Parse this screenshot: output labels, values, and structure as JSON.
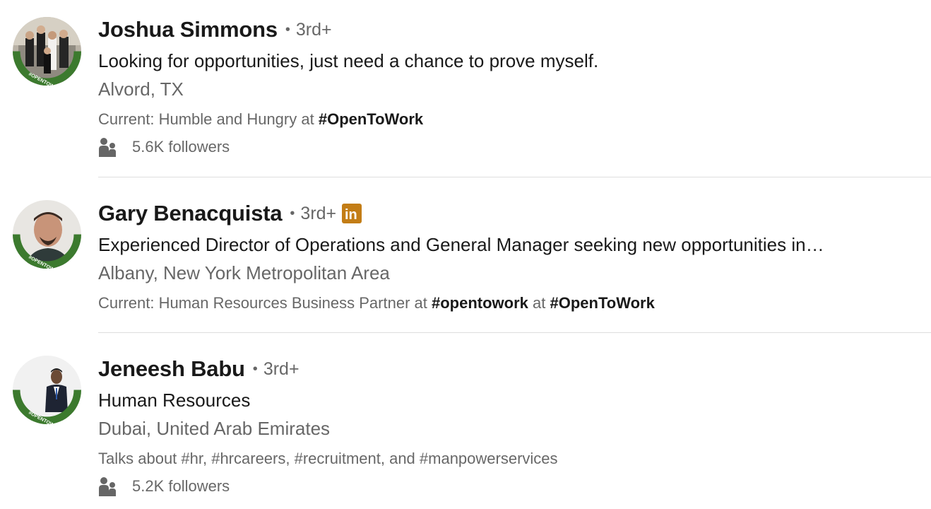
{
  "results": [
    {
      "name": "Joshua Simmons",
      "separator": "•",
      "degree": "3rd+",
      "headline": "Looking for opportunities, just need a chance to prove myself.",
      "location": "Alvord, TX",
      "summary_prefix": "Current: Humble and Hungry at ",
      "summary_hash1": "#",
      "summary_tag1": "OpenToWork",
      "followers": "5.6K followers",
      "avatar_frame_text": "#OPENTOWORK"
    },
    {
      "name": "Gary Benacquista",
      "separator": "•",
      "degree": "3rd+",
      "badge_text": "in",
      "headline": "Experienced Director of Operations and General Manager seeking new opportunities in…",
      "location": "Albany, New York Metropolitan Area",
      "summary_prefix": "Current: Human Resources Business Partner at ",
      "summary_hash1": "#",
      "summary_tag1": "opentowork",
      "summary_mid": " at ",
      "summary_hash2": "#",
      "summary_tag2": "OpenToWork",
      "avatar_frame_text": "#OPENTOWORK"
    },
    {
      "name": "Jeneesh Babu",
      "separator": "•",
      "degree": "3rd+",
      "headline": "Human Resources",
      "location": "Dubai, United Arab Emirates",
      "summary": "Talks about #hr, #hrcareers, #recruitment, and #manpowerservices",
      "followers": "5.2K followers",
      "avatar_frame_text": "#OPENTOWORK"
    }
  ],
  "colors": {
    "opentowork_green": "#3c7a2e",
    "premium_badge": "#c37d16",
    "divider": "#dedede"
  },
  "icons": {
    "followers": "people-icon",
    "premium": "linkedin-premium-icon"
  }
}
